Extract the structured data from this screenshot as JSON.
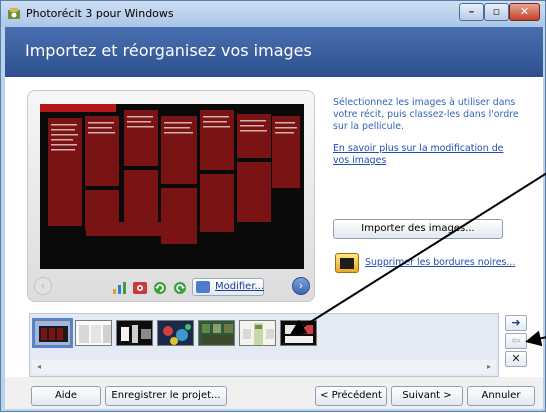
{
  "window": {
    "title": "Photorécit 3 pour Windows",
    "controls": {
      "minimize": "–",
      "maximize": "▫",
      "close": "✕"
    }
  },
  "header": {
    "title": "Importez et réorganisez vos images"
  },
  "preview": {
    "nav_prev": "‹",
    "nav_next": "›",
    "modifier_label": "Modifier...",
    "slide": {
      "title": "Show Tes, Ch 8, The Day",
      "subtitle": "Fill your day's timeline with dream moments of your work"
    }
  },
  "instructions": {
    "text": "Sélectionnez les images à utiliser dans votre récit, puis classez-les dans l'ordre sur la pellicule.",
    "link": "En savoir plus sur la modification de vos images"
  },
  "import_button": "Importer des images...",
  "borders_link": "Supprimer les bordures noires...",
  "filmstrip": {
    "thumbnails": [
      {
        "name": "thumb-1",
        "selected": true
      },
      {
        "name": "thumb-2",
        "selected": false
      },
      {
        "name": "thumb-3",
        "selected": false
      },
      {
        "name": "thumb-4",
        "selected": false
      },
      {
        "name": "thumb-5",
        "selected": false
      },
      {
        "name": "thumb-6",
        "selected": false
      },
      {
        "name": "thumb-7",
        "selected": false
      }
    ],
    "scroll_left": "◂",
    "scroll_right": "▸"
  },
  "side_buttons": {
    "move_right": "➜",
    "move_left": "⇦",
    "delete": "✕"
  },
  "footer": {
    "help": "Aide",
    "save": "Enregistrer le projet...",
    "previous": "< Précédent",
    "next": "Suivant >",
    "cancel": "Annuler"
  },
  "colors": {
    "header_bg": "#3a5e9f",
    "link": "#1f4fb5",
    "slide_bg": "#0a0a0a",
    "card_red": "#7a1414"
  }
}
